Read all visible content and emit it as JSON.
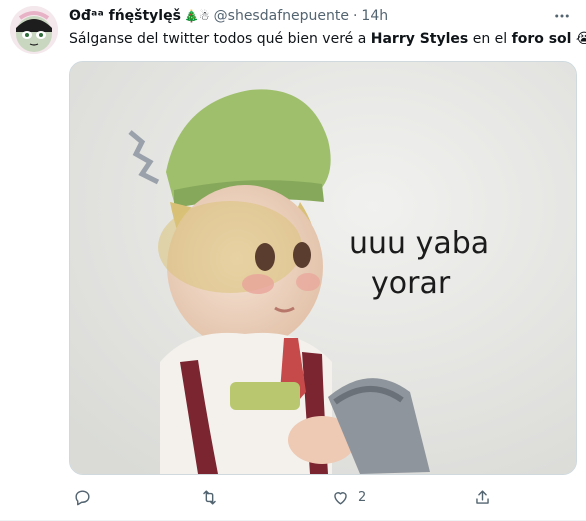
{
  "tweet": {
    "display_name": "ʘđᵃᵃ fńęštylęš",
    "display_name_emoji": "🎄☃",
    "handle": "@shesdafnepuente",
    "separator": "·",
    "time": "14h",
    "text_parts": [
      {
        "text": "Sálganse del twitter todos qué bien veré a ",
        "bold": false
      },
      {
        "text": "Harry Styles",
        "bold": true
      },
      {
        "text": " en el ",
        "bold": false
      },
      {
        "text": "foro sol",
        "bold": true
      },
      {
        "text": " 😭",
        "bold": false
      }
    ],
    "image_caption_line1": "uuu yaba",
    "image_caption_line2": "yorar"
  },
  "actions": {
    "reply_icon": "reply-icon",
    "retweet_icon": "retweet-icon",
    "like_icon": "heart-icon",
    "like_count": "2",
    "share_icon": "share-icon"
  },
  "colors": {
    "text_primary": "#0f1419",
    "text_secondary": "#536471",
    "border": "#cfd9de"
  }
}
